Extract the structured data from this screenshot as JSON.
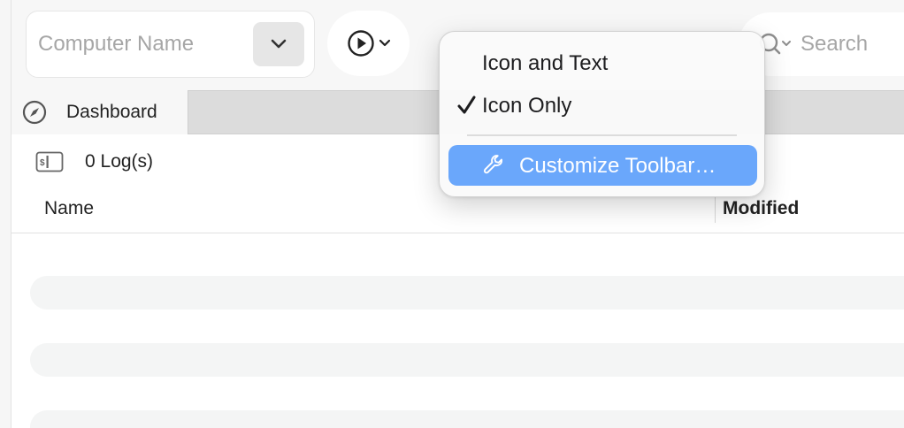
{
  "toolbar": {
    "computer_name": {
      "value": "",
      "placeholder": "Computer Name"
    },
    "search": {
      "value": "",
      "placeholder": "Search"
    }
  },
  "tabs": [
    {
      "label": "Dashboard",
      "icon": "compass-icon",
      "active": true
    }
  ],
  "logs": {
    "count_label": "0 Log(s)",
    "icon": "log-console-icon"
  },
  "table": {
    "columns": [
      "Name",
      "Modified"
    ],
    "rows": []
  },
  "menu": {
    "items": [
      {
        "label": "Icon and Text",
        "checked": false
      },
      {
        "label": "Icon Only",
        "checked": true
      }
    ],
    "customize_label": "Customize Toolbar…"
  },
  "colors": {
    "highlight": "#6aa7fb",
    "toolbar_bg": "#f7f7f7",
    "tabbar_bg": "#dcdcdc"
  }
}
